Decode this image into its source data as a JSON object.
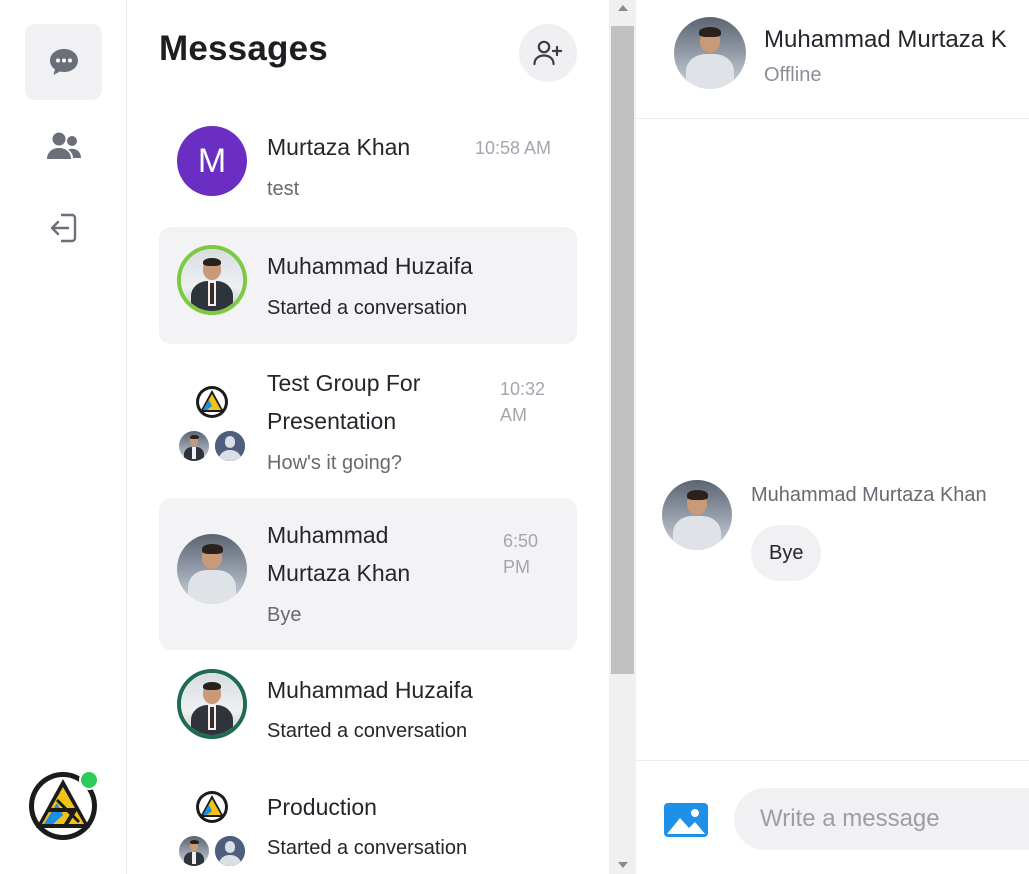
{
  "rail": {
    "items": [
      {
        "icon": "chat-bubble-icon",
        "active": true
      },
      {
        "icon": "users-icon",
        "active": false
      },
      {
        "icon": "logout-icon",
        "active": false
      }
    ],
    "profile_status": "online"
  },
  "list": {
    "title": "Messages",
    "conversations": [
      {
        "name": "Murtaza Khan",
        "initial": "M",
        "preview": "test",
        "time": "10:58 AM",
        "selected": false
      },
      {
        "name": "Muhammad Huzaifa",
        "preview": "Started a conversation",
        "time": "",
        "selected": true
      },
      {
        "name": "Test Group For Presentation",
        "name_lines": [
          "Test Group For",
          "Presentation"
        ],
        "preview": "How's it going?",
        "time_lines": [
          "10:32",
          "AM"
        ],
        "selected": false
      },
      {
        "name": "Muhammad Murtaza Khan",
        "name_lines": [
          "Muhammad",
          "Murtaza Khan"
        ],
        "preview": "Bye",
        "time_lines": [
          "6:50",
          "PM"
        ],
        "selected": true
      },
      {
        "name": "Muhammad Huzaifa",
        "preview": "Started a conversation",
        "time": "",
        "selected": false
      },
      {
        "name": "Production",
        "preview": "Started a conversation",
        "time": "",
        "selected": false
      }
    ]
  },
  "chat": {
    "header": {
      "name": "Muhammad Murtaza K",
      "status": "Offline"
    },
    "messages": [
      {
        "sender": "Muhammad Murtaza Khan",
        "text": "Bye"
      }
    ],
    "composer": {
      "placeholder": "Write a message"
    }
  },
  "colors": {
    "accent_purple": "#6a2fc2",
    "online_green": "#2bcb5c",
    "image_button_blue": "#1e90e8",
    "selected_bg": "#f3f3f5"
  }
}
